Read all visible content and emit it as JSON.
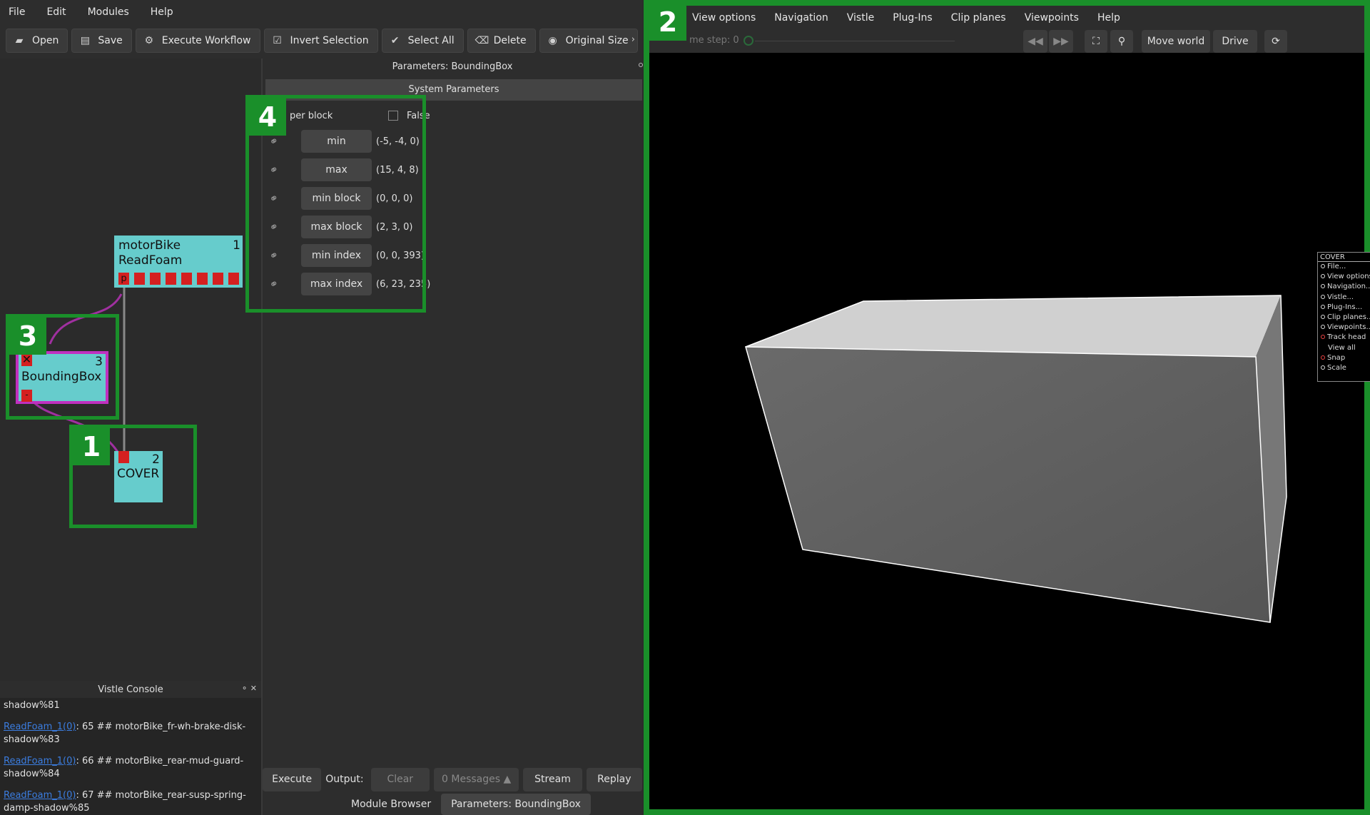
{
  "menu": [
    "File",
    "Edit",
    "Modules",
    "Help"
  ],
  "toolbar": {
    "open": "Open",
    "save": "Save",
    "execute_workflow": "Execute Workflow",
    "invert_selection": "Invert Selection",
    "select_all": "Select All",
    "delete": "Delete",
    "original_size": "Original Size",
    "more": "›"
  },
  "nodes": {
    "readfoam": {
      "line1": "motorBike",
      "line2": "ReadFoam",
      "id": "1",
      "port_label": "p"
    },
    "boundingbox": {
      "title": "BoundingBox",
      "id": "3",
      "port_label": "-"
    },
    "cover": {
      "title": "COVER",
      "id": "2"
    }
  },
  "parameters": {
    "title": "Parameters: BoundingBox",
    "system_params": "System Parameters",
    "per_block_label": "per block",
    "per_block_value": "False",
    "rows": [
      {
        "button": "min",
        "value": "(-5, -4, 0)"
      },
      {
        "button": "max",
        "value": "(15, 4, 8)"
      },
      {
        "button": "min block",
        "value": "(0, 0, 0)"
      },
      {
        "button": "max block",
        "value": "(2, 3, 0)"
      },
      {
        "button": "min index",
        "value": "(0, 0, 393)"
      },
      {
        "button": "max index",
        "value": "(6, 23, 235)"
      }
    ]
  },
  "console": {
    "title": "Vistle Console",
    "controls": "⚬ ✕",
    "lines": [
      {
        "text": "shadow%81"
      },
      {
        "link": "ReadFoam_1(0)",
        "text": ": 65 ## motorBike_fr-wh-brake-disk-shadow%83"
      },
      {
        "link": "ReadFoam_1(0)",
        "text": ": 66 ## motorBike_rear-mud-guard-shadow%84"
      },
      {
        "link": "ReadFoam_1(0)",
        "text": ": 67 ## motorBike_rear-susp-spring-damp-shadow%85"
      }
    ]
  },
  "bottom": {
    "execute": "Execute",
    "output": "Output:",
    "clear": "Clear",
    "messages": "0 Messages ▲",
    "stream": "Stream",
    "replay": "Replay"
  },
  "tabs": {
    "module_browser": "Module Browser",
    "parameters": "Parameters: BoundingBox"
  },
  "viewer": {
    "menu": [
      "View options",
      "Navigation",
      "Vistle",
      "Plug-Ins",
      "Clip planes",
      "Viewpoints",
      "Help"
    ],
    "timestep": "me step: 0",
    "move_world": "Move world",
    "drive": "Drive",
    "cover_menu": {
      "header": "COVER",
      "items": [
        {
          "label": "File...",
          "marker": true
        },
        {
          "label": "View options...",
          "marker": true
        },
        {
          "label": "Navigation...",
          "marker": true
        },
        {
          "label": "Vistle...",
          "marker": true
        },
        {
          "label": "Plug-Ins...",
          "marker": true
        },
        {
          "label": "Clip planes...",
          "marker": true
        },
        {
          "label": "Viewpoints...",
          "marker": true
        },
        {
          "label": "Track head",
          "marker": true,
          "red": true
        },
        {
          "label": "View all",
          "marker": false
        },
        {
          "label": "Snap",
          "marker": true,
          "red": true
        },
        {
          "label": "Scale",
          "marker": true
        }
      ]
    }
  },
  "annotations": [
    "1",
    "2",
    "3",
    "4"
  ],
  "colors": {
    "accent_green": "#1a8f2a",
    "node_cyan": "#66cccc",
    "port_red": "#d42020",
    "selected_magenta": "#c030c0"
  }
}
